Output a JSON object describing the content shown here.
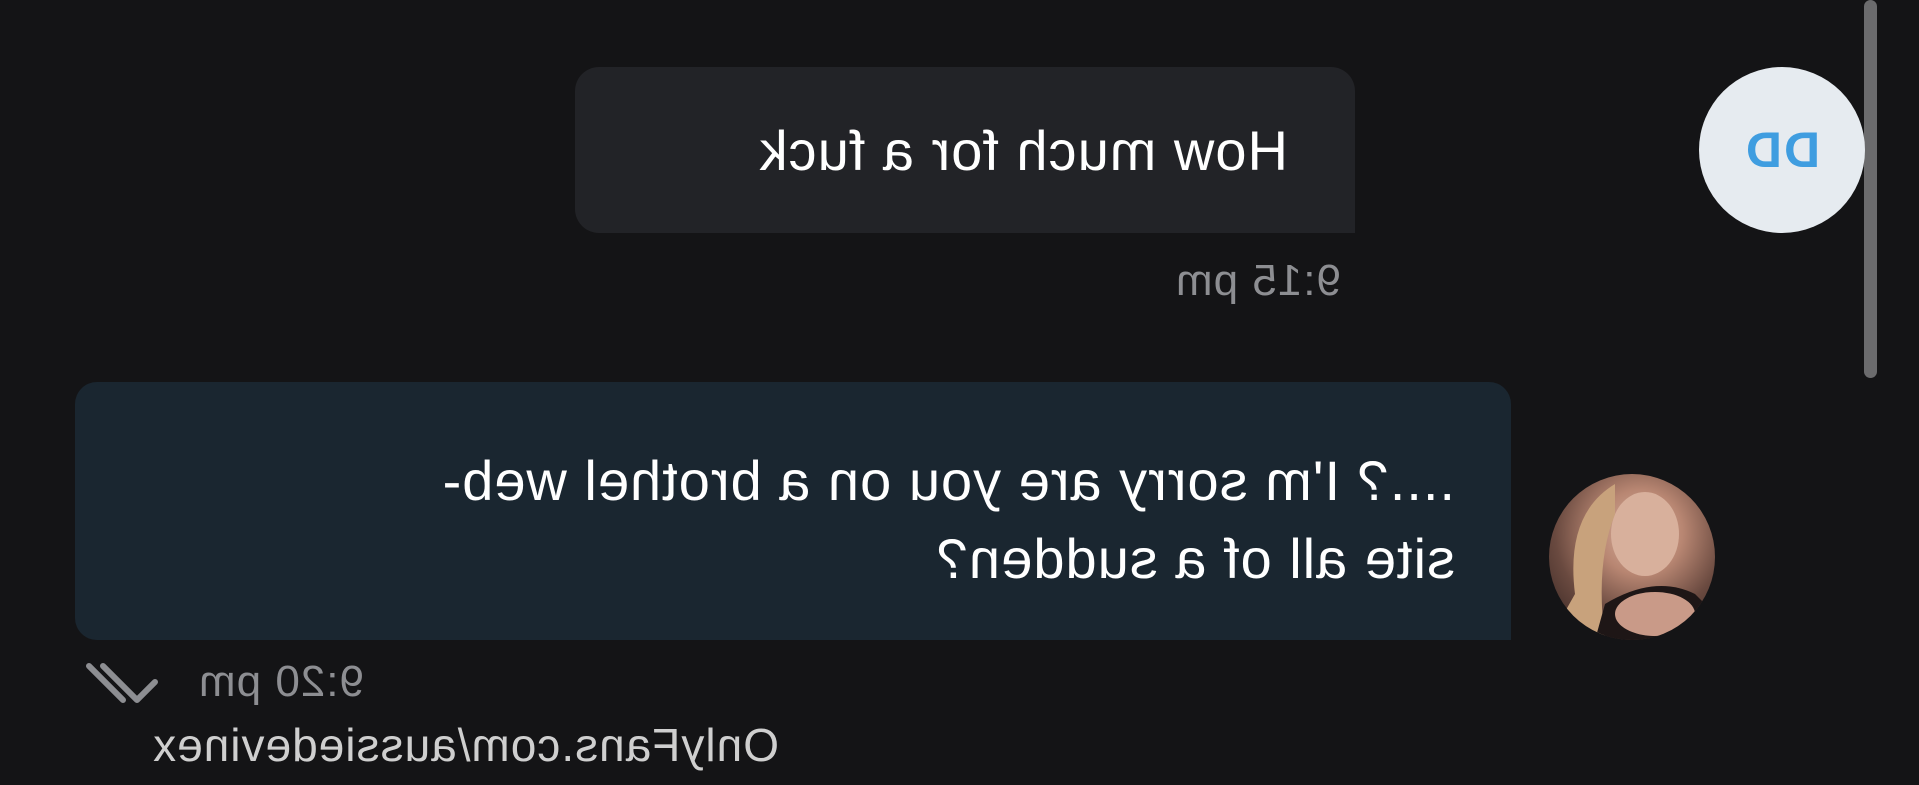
{
  "conversation": {
    "incoming": {
      "avatar_initials": "DD",
      "text": "How much for a fuck",
      "time": "9:15 pm"
    },
    "outgoing": {
      "text_line1": "....? I'm sorry are you on a brothel web-",
      "text_line2": "site all of a sudden?",
      "time": "9:20 pm",
      "status_icon": "double-check-icon"
    }
  },
  "watermark": "OnlyFans.com/aussiedevinex",
  "colors": {
    "background": "#141416",
    "incoming_bubble": "#222327",
    "outgoing_bubble": "#1a2630",
    "avatar_initials": "#3f9de0",
    "avatar_bg": "#e6ebf0",
    "timestamp": "#8d8e92"
  }
}
